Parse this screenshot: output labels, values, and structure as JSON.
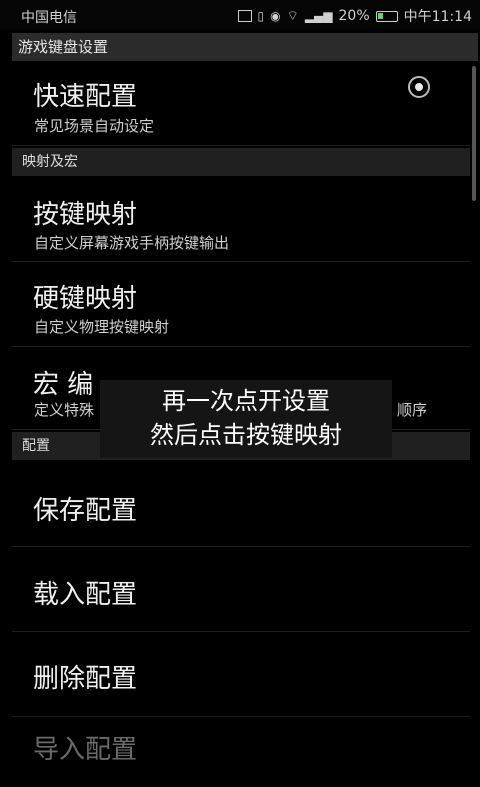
{
  "status_bar": {
    "carrier": "中国电信",
    "battery": "20%",
    "time": "中午11:14"
  },
  "header": {
    "title": "游戏键盘设置"
  },
  "items": {
    "quick_config": {
      "title": "快速配置",
      "subtitle": "常见场景自动设定",
      "selected": true
    },
    "key_mapping": {
      "title": "按键映射",
      "subtitle": "自定义屏幕游戏手柄按键输出"
    },
    "hard_key_mapping": {
      "title": "硬键映射",
      "subtitle": "自定义物理按键映射"
    },
    "macro_edit": {
      "title": "宏 编",
      "subtitle_left": "定义特殊",
      "subtitle_right": "顺序"
    },
    "save": {
      "title": "保存配置"
    },
    "load": {
      "title": "载入配置"
    },
    "delete": {
      "title": "删除配置"
    },
    "import": {
      "title": "导入配置"
    }
  },
  "sections": {
    "mapping_macro": "映射及宏",
    "config": "配置"
  },
  "toast": {
    "line1": "再一次点开设置",
    "line2": "然后点击按键映射"
  },
  "icons": {
    "cast": "cast-icon",
    "vibrate": "vibrate-icon",
    "eye": "eye-comfort-icon",
    "wifi": "wifi-icon",
    "signal": "signal-icon",
    "battery": "battery-icon",
    "radio": "radio-button-icon"
  }
}
